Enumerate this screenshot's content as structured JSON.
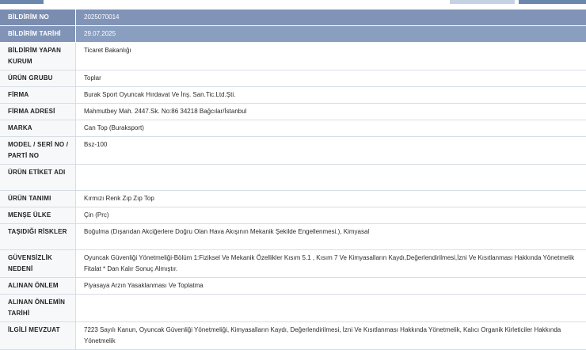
{
  "rows": [
    {
      "label": "BİLDİRİM NO",
      "value": "2025070014"
    },
    {
      "label": "BİLDİRİM TARİHİ",
      "value": "29.07.2025"
    },
    {
      "label": "BİLDİRİM YAPAN KURUM",
      "value": "Ticaret Bakanlığı"
    },
    {
      "label": "ÜRÜN GRUBU",
      "value": "Toplar"
    },
    {
      "label": "FİRMA",
      "value": "Burak Sport Oyuncak Hırdavat Ve İnş. San.Tic.Ltd.Şti."
    },
    {
      "label": "FİRMA ADRESİ",
      "value": "Mahmutbey Mah. 2447.Sk. No:86 34218 Bağcılar/İstanbul"
    },
    {
      "label": "MARKA",
      "value": "Can Top (Buraksport)"
    },
    {
      "label": "MODEL / SERİ NO / PARTİ NO",
      "value": "Bsz-100"
    },
    {
      "label": "ÜRÜN ETİKET ADI",
      "value": ""
    },
    {
      "label": "ÜRÜN TANIMI",
      "value": "Kırmızı Renk Zıp Zıp Top"
    },
    {
      "label": "MENŞE ÜLKE",
      "value": "Çin (Prc)"
    },
    {
      "label": "TAŞIDIĞI RİSKLER",
      "value": "Boğulma (Dışarıdan Akciğerlere Doğru Olan Hava Akışının Mekanik Şekilde Engellenmesi.), Kimyasal"
    },
    {
      "label": "GÜVENSİZLİK NEDENİ",
      "value": "Oyuncak Güvenliği Yönetmeliği-Bölüm 1:Fiziksel Ve Mekanik Özellikler Kısım 5.1 , Kısım 7 Ve Kimyasalların Kaydı,Değerlendirilmesi,İzni Ve Kısıtlanması Hakkında Yönetmelik Fitalat * Dan Kalır Sonuç Almıştır."
    },
    {
      "label": "ALINAN ÖNLEM",
      "value": "Piyasaya Arzın Yasaklanması Ve Toplatma"
    },
    {
      "label": "ALINAN ÖNLEMİN TARİHİ",
      "value": ""
    },
    {
      "label": "İLGİLİ MEVZUAT",
      "value": "7223 Sayılı Kanun, Oyuncak Güvenliği Yönetmeliği, Kimyasalların Kaydı, Değerlendirilmesi, İzni Ve Kısıtlanması Hakkında Yönetmelik, Kalıcı Organik Kirleticiler Hakkında Yönetmelik"
    }
  ]
}
